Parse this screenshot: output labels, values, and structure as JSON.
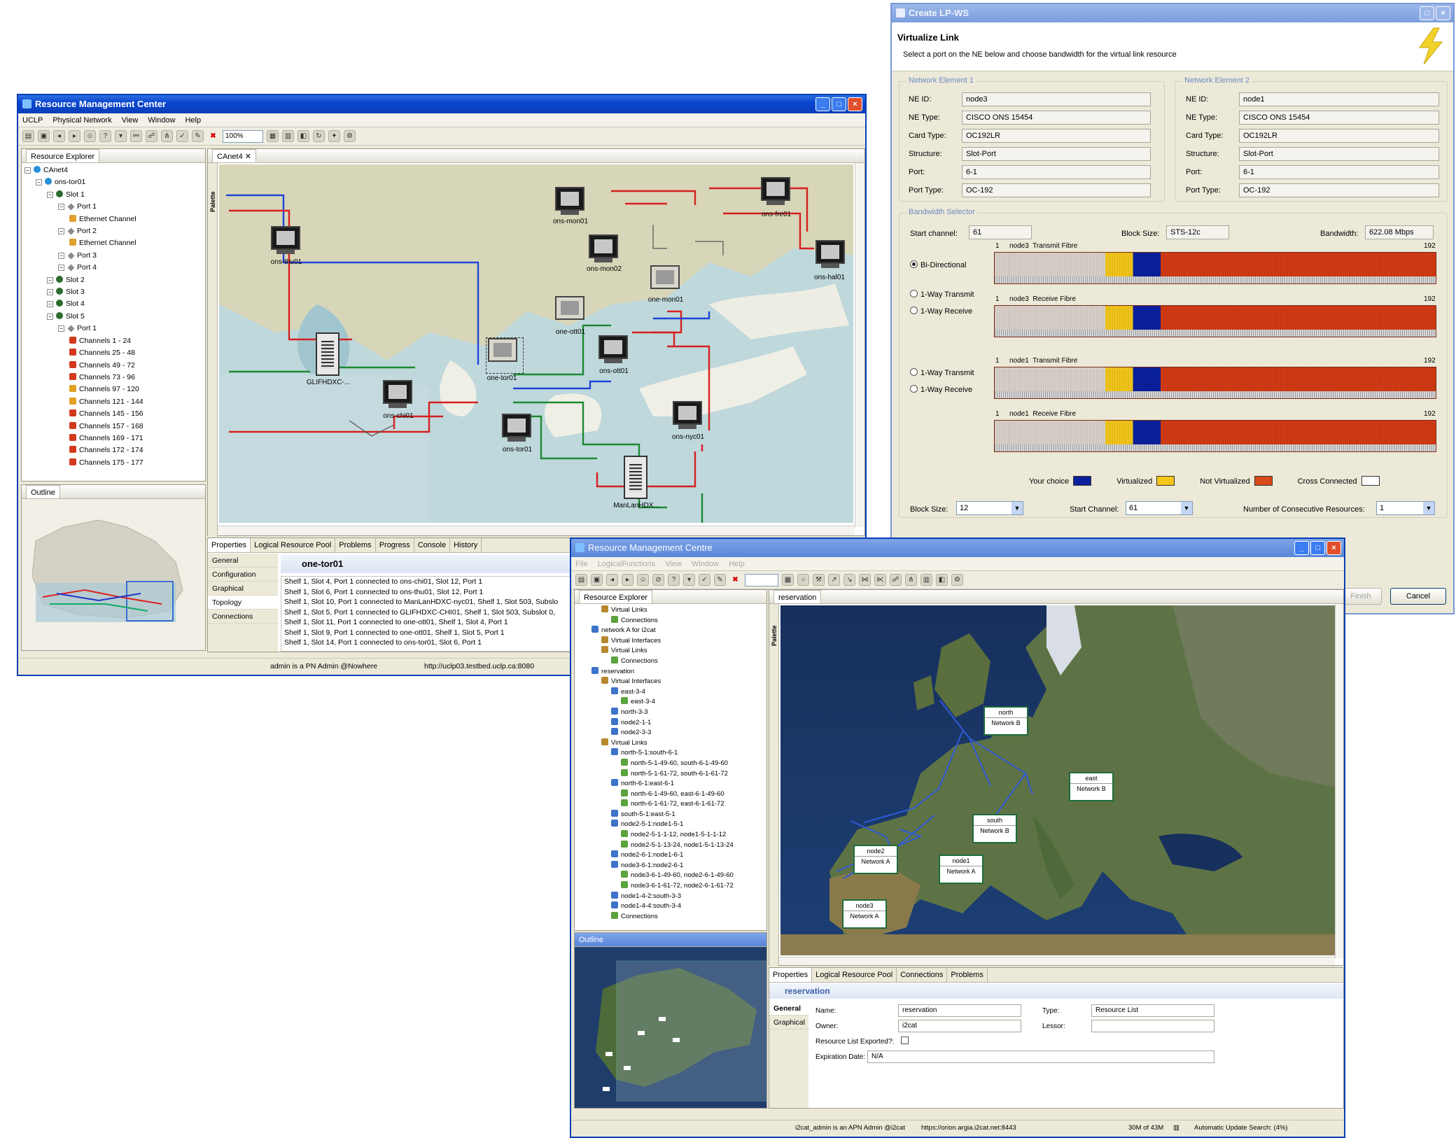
{
  "rmc_main": {
    "window_title": "Resource Management Center",
    "menu": [
      "UCLP",
      "Physical Network",
      "View",
      "Window",
      "Help"
    ],
    "zoom": "100%",
    "resource_explorer": {
      "title": "Resource Explorer",
      "tree": [
        {
          "label": "CAnet4",
          "icon": "network-icon"
        },
        {
          "label": "ons-tor01",
          "icon": "device-icon"
        },
        {
          "label": "Slot 1",
          "icon": "slot-icon"
        },
        {
          "label": "Port 1",
          "icon": "port-icon"
        },
        {
          "label": "Ethernet Channel",
          "icon": "ethernet-icon"
        },
        {
          "label": "Port 2",
          "icon": "port-icon"
        },
        {
          "label": "Ethernet Channel",
          "icon": "ethernet-icon"
        },
        {
          "label": "Port 3",
          "icon": "port-icon"
        },
        {
          "label": "Port 4",
          "icon": "port-icon"
        },
        {
          "label": "Slot 2",
          "icon": "slot-icon"
        },
        {
          "label": "Slot 3",
          "icon": "slot-icon"
        },
        {
          "label": "Slot 4",
          "icon": "slot-icon"
        },
        {
          "label": "Slot 5",
          "icon": "slot-icon"
        },
        {
          "label": "Port 1",
          "icon": "port-icon"
        },
        {
          "label": "Channels 1 - 24",
          "icon": "channel-icon"
        },
        {
          "label": "Channels 25 - 48",
          "icon": "channel-icon"
        },
        {
          "label": "Channels 49 - 72",
          "icon": "channel-icon"
        },
        {
          "label": "Channels 73 - 96",
          "icon": "channel-icon"
        },
        {
          "label": "Channels 97 - 120",
          "icon": "channel-icon"
        },
        {
          "label": "Channels 121 - 144",
          "icon": "channel-icon"
        },
        {
          "label": "Channels 145 - 156",
          "icon": "channel-icon"
        },
        {
          "label": "Channels 157 - 168",
          "icon": "channel-icon"
        },
        {
          "label": "Channels 169 - 171",
          "icon": "channel-icon"
        },
        {
          "label": "Channels 172 - 174",
          "icon": "channel-icon"
        },
        {
          "label": "Channels 175 - 177",
          "icon": "channel-icon"
        }
      ]
    },
    "editor_tab": "CAnet4",
    "palette_label": "Palette",
    "outline_title": "Outline",
    "devices": [
      "ons-thu01",
      "ons-mon01",
      "ons-fre01",
      "ons-mon02",
      "ons-hal01",
      "one-mon01",
      "one-ott01",
      "ons-ott01",
      "GLIFHDXC-...",
      "one-tor01",
      "ons-chi01",
      "ons-tor01",
      "ons-nyc01",
      "ManLanHDX..."
    ],
    "bottom_tabs": [
      "Properties",
      "Logical Resource Pool",
      "Problems",
      "Progress",
      "Console",
      "History"
    ],
    "prop_side_tabs": [
      "General",
      "Configuration",
      "Graphical",
      "Topology",
      "Connections"
    ],
    "selected_object": "one-tor01",
    "connections": [
      "Shelf 1, Slot 4, Port 1 connected to ons-chi01, Slot 12, Port 1",
      "Shelf 1, Slot 6, Port 1 connected to ons-thu01, Slot 12, Port 1",
      "Shelf 1, Slot 10, Port 1 connected to ManLanHDXC-nyc01, Shelf 1, Slot 503, Subslo",
      "Shelf 1, Slot 5, Port 1 connected to GLIFHDXC-CHI01, Shelf 1, Slot 503, Subslot 0,",
      "Shelf 1, Slot 11, Port 1 connected to one-ott01, Shelf 1, Slot 4, Port 1",
      "Shelf 1, Slot 9, Port 1 connected to one-ott01, Shelf 1, Slot 5, Port 1",
      "Shelf 1, Slot 14, Port 1 connected to ons-tor01, Slot 6, Port 1"
    ],
    "status_user": "admin is a PN Admin @Nowhere",
    "status_url": "http://uclp03.testbed.uclp.ca:8080"
  },
  "lpws": {
    "window_title": "Create LP-WS",
    "heading": "Virtualize Link",
    "subheading": "Select a port on the NE below and choose bandwidth for the virtual link resource",
    "ne1": {
      "group": "Network Element 1",
      "ne_id": "node3",
      "ne_type": "CISCO ONS 15454",
      "card_type": "OC192LR",
      "structure": "Slot-Port",
      "port": "6-1",
      "port_type": "OC-192"
    },
    "ne2": {
      "group": "Network Element 2",
      "ne_id": "node1",
      "ne_type": "CISCO ONS 15454",
      "card_type": "OC192LR",
      "structure": "Slot-Port",
      "port": "6-1",
      "port_type": "OC-192"
    },
    "labels": {
      "ne_id": "NE ID:",
      "ne_type": "NE Type:",
      "card_type": "Card Type:",
      "structure": "Structure:",
      "port": "Port:",
      "port_type": "Port Type:"
    },
    "bandwidth_selector": "Bandwidth Selector",
    "start_channel_label": "Start channel:",
    "start_channel": "61",
    "block_size_label": "Block Size:",
    "block_size": "STS-12c",
    "bandwidth_label": "Bandwidth:",
    "bandwidth": "622.08 Mbps",
    "radios": [
      "Bi-Directional",
      "1-Way Transmit",
      "1-Way Receive",
      "1-Way Transmit",
      "1-Way Receive"
    ],
    "bars": [
      {
        "start": "1",
        "label": "node3  Transmit Fibre",
        "end": "192"
      },
      {
        "start": "1",
        "label": "node3  Receive Fibre",
        "end": "192"
      },
      {
        "start": "1",
        "label": "node1  Transmit Fibre",
        "end": "192"
      },
      {
        "start": "1",
        "label": "node1  Receive Fibre",
        "end": "192"
      }
    ],
    "legend": [
      {
        "label": "Your choice",
        "color": "#0a1f9c"
      },
      {
        "label": "Virtualized",
        "color": "#f5c518"
      },
      {
        "label": "Not Virtualized",
        "color": "#d94a1a"
      },
      {
        "label": "Cross Connected",
        "color": "#ffffff"
      }
    ],
    "block_size_select_label": "Block Size:",
    "block_size_select": "12",
    "start_channel_select_label": "Start Channel:",
    "start_channel_select": "61",
    "consecutive_label": "Number of Consecutive Resources:",
    "consecutive": "1",
    "finish": "Finish",
    "cancel": "Cancel"
  },
  "rmc_europe": {
    "window_title": "Resource Management Centre",
    "menu": [
      "File",
      "LogicalFunctions",
      "View",
      "Window",
      "Help"
    ],
    "explorer_title": "Resource Explorer",
    "tree": [
      "Virtual Links",
      "Connections",
      "network A for i2cat",
      "Virtual Interfaces",
      "Virtual Links",
      "Connections",
      "reservation",
      "Virtual Interfaces",
      "east-3-4",
      "east-3-4",
      "north-3-3",
      "node2-1-1",
      "node2-3-3",
      "Virtual Links",
      "north-5-1:south-6-1",
      "north-5-1-49-60, south-6-1-49-60",
      "north-5-1-61-72, south-6-1-61-72",
      "north-6-1:east-6-1",
      "north-6-1-49-60, east-6-1-49-60",
      "north-6-1-61-72, east-6-1-61-72",
      "south-5-1:east-5-1",
      "node2-5-1:node1-5-1",
      "node2-5-1-1-12, node1-5-1-1-12",
      "node2-5-1-13-24, node1-5-1-13-24",
      "node2-6-1:node1-6-1",
      "node3-6-1:node2-6-1",
      "node3-6-1-49-60, node2-6-1-49-60",
      "node3-6-1-61-72, node2-6-1-61-72",
      "node1-4-2:south-3-3",
      "node1-4-4:south-3-4",
      "Connections"
    ],
    "editor_tab": "reservation",
    "palette_label": "Palette",
    "outline_title": "Outline",
    "nodes": [
      {
        "name": "north",
        "net": "Network B"
      },
      {
        "name": "east",
        "net": "Network B"
      },
      {
        "name": "south",
        "net": "Network B"
      },
      {
        "name": "node2",
        "net": "Network A"
      },
      {
        "name": "node1",
        "net": "Network A"
      },
      {
        "name": "node3",
        "net": "Network A"
      }
    ],
    "bottom_tabs": [
      "Properties",
      "Logical Resource Pool",
      "Connections",
      "Problems"
    ],
    "selected_object": "reservation",
    "side_tabs": [
      "General",
      "Graphical"
    ],
    "name_label": "Name:",
    "name": "reservation",
    "type_label": "Type:",
    "type": "Resource List",
    "owner_label": "Owner:",
    "owner": "i2cat",
    "lessor_label": "Lessor:",
    "lessor": "",
    "exported_label": "Resource List Exported?:",
    "expiration_label": "Expiration Date:",
    "expiration": "N/A",
    "status_user": "i2cat_admin is an APN Admin @i2cat",
    "status_url": "https://orion.argia.i2cat.net:8443",
    "memory": "30M of 43M",
    "auto_update": "Automatic Update Search: (4%)"
  }
}
